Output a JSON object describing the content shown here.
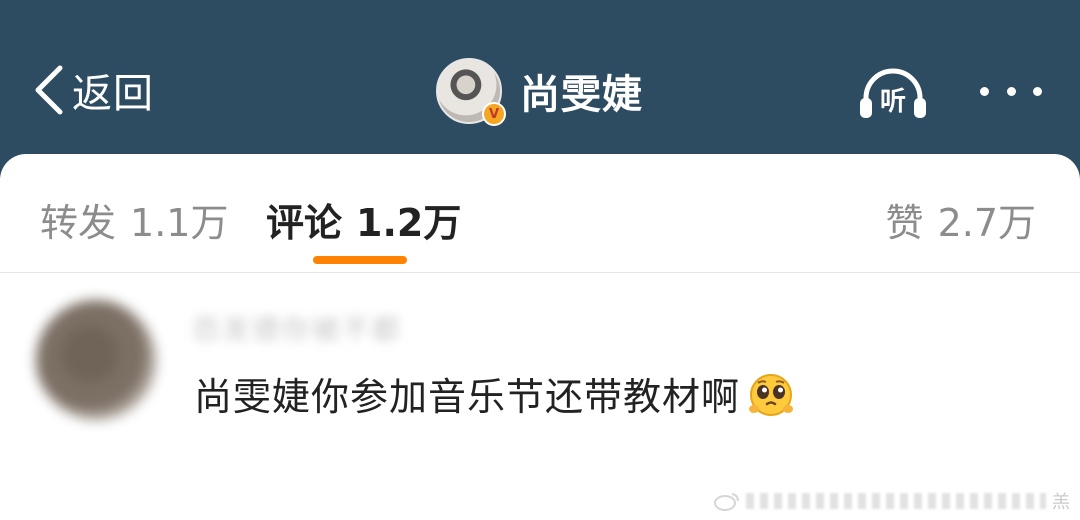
{
  "nav": {
    "back_label": "返回",
    "profile_name": "尚雯婕",
    "verified_badge": "V",
    "listen_label": "听"
  },
  "tabs": [
    {
      "label": "转发",
      "count": "1.1万",
      "active": false
    },
    {
      "label": "评论",
      "count": "1.2万",
      "active": true
    },
    {
      "label": "赞",
      "count": "2.7万",
      "active": false
    }
  ],
  "comment": {
    "username": "恐发德你被不都",
    "text": "尚雯婕你参加音乐节还带教材啊",
    "emoji": "pleading-face-emoji"
  },
  "watermark": {
    "text": "羔"
  },
  "colors": {
    "header_bg": "#2d4b61",
    "accent": "#ff8200",
    "badge": "#f5a623"
  }
}
